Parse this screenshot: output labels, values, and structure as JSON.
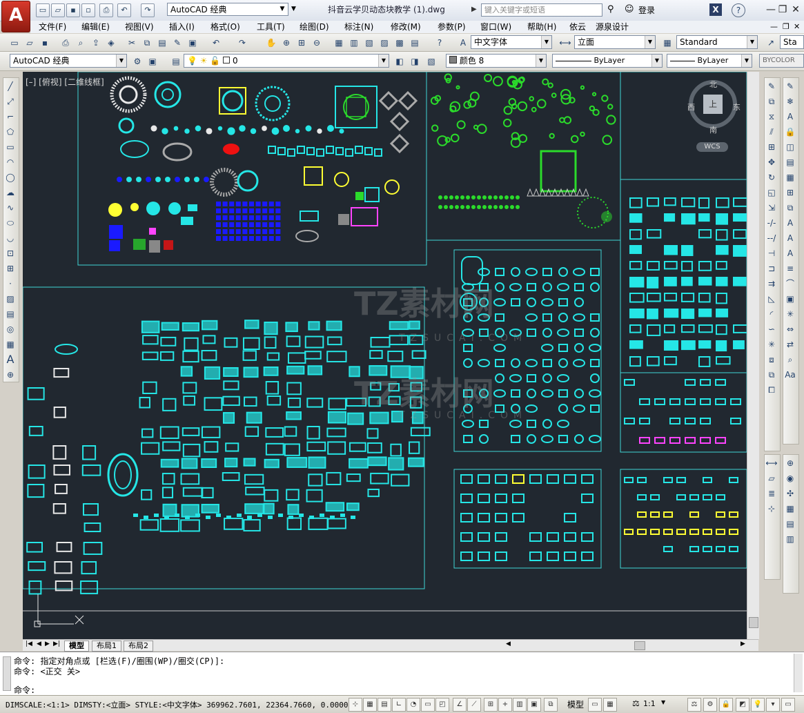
{
  "app": {
    "logo_letter": "A",
    "workspace": "AutoCAD 经典",
    "document_title": "抖音云学贝动态块教学 (1).dwg",
    "search_placeholder": "键入关键字或短语",
    "login_label": "登录",
    "window_buttons": [
      "—",
      "❐",
      "✕"
    ]
  },
  "menu": {
    "items": [
      "文件(F)",
      "编辑(E)",
      "视图(V)",
      "插入(I)",
      "格式(O)",
      "工具(T)",
      "绘图(D)",
      "标注(N)",
      "修改(M)",
      "参数(P)",
      "窗口(W)",
      "帮助(H)",
      "依云",
      "源泉设计"
    ]
  },
  "toolbar_styles": {
    "text_style": "中文字体",
    "dim_style": "立面",
    "table_style": "Standard",
    "multileader_style": "Sta"
  },
  "toolbar_layers": {
    "workspace": "AutoCAD 经典",
    "layer": "0",
    "color": "颜色 8",
    "linetype": "ByLayer",
    "lineweight": "ByLayer",
    "plotstyle": "BYCOLOR"
  },
  "drawing": {
    "viewport_label": "[–] [俯视] [二维线框]",
    "viewcube": {
      "north": "北",
      "south": "南",
      "east": "东",
      "west": "西",
      "face": "上",
      "wcs": "WCS"
    },
    "watermark_text": "TZ素材网",
    "watermark_sub": "TZSUCAI.COM",
    "colors": {
      "background": "#212830",
      "frame": "#3fd6d6",
      "cyan": "#25e6e6",
      "white": "#e8e8e8",
      "green": "#2bdb2b",
      "blue": "#1a1aff",
      "yellow": "#ffff33",
      "red": "#ff2222"
    }
  },
  "tabs": {
    "items": [
      "模型",
      "布局1",
      "布局2"
    ],
    "active": "模型"
  },
  "command": {
    "history": [
      "命令: 指定对角点或 [栏选(F)/圈围(WP)/圈交(CP)]:",
      "命令:  <正交 关>"
    ],
    "prompt": "命令:"
  },
  "status": {
    "text": "DIMSCALE:<1:1> DIMSTY:<立面> STYLE:<中文字体>  369962.7601, 22364.7660, 0.0000",
    "model_label": "模型",
    "scale_label": "1:1"
  }
}
